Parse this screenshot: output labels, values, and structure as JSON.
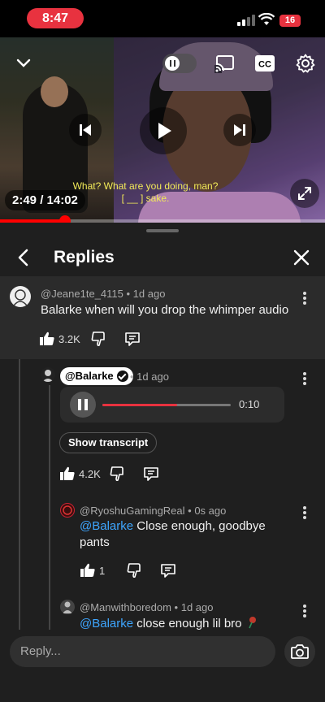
{
  "status_bar": {
    "time": "8:47",
    "battery": "16"
  },
  "video": {
    "subtitle_line1": "What? What are you doing, man?",
    "subtitle_line2": "[ __ ] sake.",
    "time_display": "2:49 / 14:02",
    "progress": 0.2
  },
  "panel": {
    "title": "Replies"
  },
  "comments": {
    "parent": {
      "author": "@Jeane1te_4115",
      "age": "1d ago",
      "text": "Balarke when will you drop the whimper audio",
      "likes": "3.2K"
    },
    "creator_reply": {
      "author": "@Balarke",
      "age": "1d ago",
      "audio_time": "0:10",
      "audio_progress": 0.58,
      "transcript_label": "Show transcript",
      "likes": "4.2K"
    },
    "reply1": {
      "author": "@RyoshuGamingReal",
      "age": "0s ago",
      "mention": "@Balarke",
      "text_line1": "Close enough, goodbye",
      "text_line2": "pants",
      "likes": "1"
    },
    "reply2": {
      "author": "@Manwithboredom",
      "age": "1d ago",
      "mention": "@Balarke",
      "text": "close enough lil bro"
    }
  },
  "reply_bar": {
    "placeholder": "Reply..."
  },
  "icons": {
    "back": "chevron-left-icon",
    "close": "close-icon",
    "like": "thumbs-up-icon",
    "dislike": "thumbs-down-icon",
    "reply": "comment-icon",
    "more": "more-vertical-icon",
    "camera": "camera-icon",
    "cast": "cast-icon",
    "captions": "cc-icon",
    "settings": "gear-icon"
  },
  "colors": {
    "accent_red": "#e8323f",
    "mention_blue": "#3ea6ff",
    "subtitle_yellow": "#f2ea58"
  }
}
